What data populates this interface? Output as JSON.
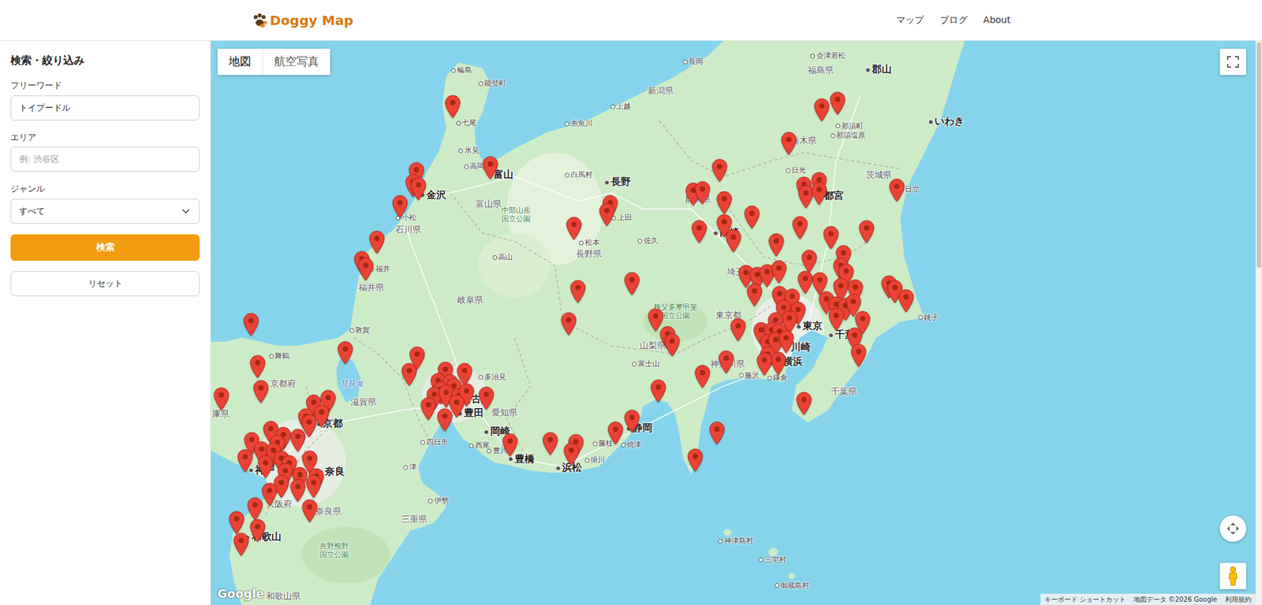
{
  "brand": {
    "name": "Doggy Map"
  },
  "nav": [
    {
      "label": "マップ"
    },
    {
      "label": "ブログ"
    },
    {
      "label": "About"
    }
  ],
  "sidebar": {
    "title": "検索・絞り込み",
    "fields": [
      {
        "label": "フリーワード",
        "kind": "text",
        "value": "トイプードル"
      },
      {
        "label": "エリア",
        "kind": "placeholder",
        "placeholder": "例: 渋谷区"
      },
      {
        "label": "ジャンル",
        "kind": "select",
        "value": "すべて"
      }
    ],
    "buttons": [
      {
        "label": "検索",
        "kind": "primary"
      },
      {
        "label": "リセット",
        "kind": "outline"
      }
    ]
  },
  "map": {
    "type_control": [
      {
        "label": "地図",
        "selected": true
      },
      {
        "label": "航空写真",
        "selected": false
      }
    ],
    "labels": [
      {
        "text": "輪島",
        "kind": "town"
      },
      {
        "text": "能登町",
        "kind": "town"
      },
      {
        "text": "七尾",
        "kind": "town"
      },
      {
        "text": "氷見",
        "kind": "town"
      },
      {
        "text": "高岡",
        "kind": "town"
      },
      {
        "text": "富山",
        "kind": "city"
      },
      {
        "text": "金沢",
        "kind": "city"
      },
      {
        "text": "小松",
        "kind": "town"
      },
      {
        "text": "石川県",
        "kind": "pref"
      },
      {
        "text": "富山県",
        "kind": "pref"
      },
      {
        "text": "福井",
        "kind": "town"
      },
      {
        "text": "福井県",
        "kind": "pref"
      },
      {
        "text": "上越",
        "kind": "town"
      },
      {
        "text": "糸魚川",
        "kind": "town"
      },
      {
        "text": "白馬村",
        "kind": "town"
      },
      {
        "text": "長野",
        "kind": "city"
      },
      {
        "text": "上田",
        "kind": "town"
      },
      {
        "text": "佐久",
        "kind": "town"
      },
      {
        "text": "松本",
        "kind": "town"
      },
      {
        "text": "長野県",
        "kind": "pref"
      },
      {
        "text": "高山",
        "kind": "town"
      },
      {
        "text": "中部山岳国立公園",
        "kind": "park"
      },
      {
        "text": "岐阜県",
        "kind": "pref"
      },
      {
        "text": "新潟県",
        "kind": "pref"
      },
      {
        "text": "長岡",
        "kind": "town"
      },
      {
        "text": "会津若松",
        "kind": "town"
      },
      {
        "text": "福島県",
        "kind": "pref"
      },
      {
        "text": "郡山",
        "kind": "city"
      },
      {
        "text": "那須町",
        "kind": "town"
      },
      {
        "text": "那須塩原",
        "kind": "town"
      },
      {
        "text": "栃木県",
        "kind": "pref"
      },
      {
        "text": "いわき",
        "kind": "city"
      },
      {
        "text": "日光",
        "kind": "town"
      },
      {
        "text": "宇都宮",
        "kind": "city"
      },
      {
        "text": "茨城県",
        "kind": "pref"
      },
      {
        "text": "日立",
        "kind": "town"
      },
      {
        "text": "群馬県",
        "kind": "pref"
      },
      {
        "text": "高崎",
        "kind": "city"
      },
      {
        "text": "埼玉県",
        "kind": "pref"
      },
      {
        "text": "秩父多摩甲斐国立公園",
        "kind": "park"
      },
      {
        "text": "東京都",
        "kind": "pref"
      },
      {
        "text": "東京",
        "kind": "city"
      },
      {
        "text": "川崎",
        "kind": "city"
      },
      {
        "text": "横浜",
        "kind": "city"
      },
      {
        "text": "千葉",
        "kind": "city"
      },
      {
        "text": "千葉県",
        "kind": "pref"
      },
      {
        "text": "銚子",
        "kind": "town"
      },
      {
        "text": "山梨県",
        "kind": "pref"
      },
      {
        "text": "富士山",
        "kind": "town"
      },
      {
        "text": "神奈川県",
        "kind": "pref"
      },
      {
        "text": "藤沢",
        "kind": "town"
      },
      {
        "text": "鎌倉",
        "kind": "town"
      },
      {
        "text": "静岡",
        "kind": "city"
      },
      {
        "text": "藤枝",
        "kind": "town"
      },
      {
        "text": "焼津",
        "kind": "town"
      },
      {
        "text": "掛川",
        "kind": "town"
      },
      {
        "text": "浜松",
        "kind": "city"
      },
      {
        "text": "豊橋",
        "kind": "city"
      },
      {
        "text": "豊川",
        "kind": "town"
      },
      {
        "text": "西尾",
        "kind": "town"
      },
      {
        "text": "岡崎",
        "kind": "city"
      },
      {
        "text": "豊田",
        "kind": "city"
      },
      {
        "text": "愛知県",
        "kind": "pref"
      },
      {
        "text": "多治見",
        "kind": "town"
      },
      {
        "text": "名古屋",
        "kind": "city"
      },
      {
        "text": "四日市",
        "kind": "town"
      },
      {
        "text": "津",
        "kind": "town"
      },
      {
        "text": "伊勢",
        "kind": "town"
      },
      {
        "text": "三重県",
        "kind": "pref"
      },
      {
        "text": "滋賀県",
        "kind": "pref"
      },
      {
        "text": "琵琶湖",
        "kind": "lake"
      },
      {
        "text": "京都",
        "kind": "city"
      },
      {
        "text": "京都府",
        "kind": "pref"
      },
      {
        "text": "舞鶴",
        "kind": "town"
      },
      {
        "text": "敦賀",
        "kind": "town"
      },
      {
        "text": "神戸",
        "kind": "city"
      },
      {
        "text": "大阪府",
        "kind": "pref"
      },
      {
        "text": "奈良",
        "kind": "city"
      },
      {
        "text": "奈良県",
        "kind": "pref"
      },
      {
        "text": "和歌山",
        "kind": "city"
      },
      {
        "text": "吉野熊野国立公園",
        "kind": "park"
      },
      {
        "text": "和歌山県",
        "kind": "pref"
      },
      {
        "text": "庫県",
        "kind": "pref"
      },
      {
        "text": "神津島村",
        "kind": "town"
      },
      {
        "text": "三宅村",
        "kind": "town"
      },
      {
        "text": "御蔵島村",
        "kind": "town"
      }
    ],
    "logo": "Google",
    "attribution": [
      "キーボード ショートカット",
      "地図データ ©2026 Google",
      "利用規約"
    ]
  }
}
